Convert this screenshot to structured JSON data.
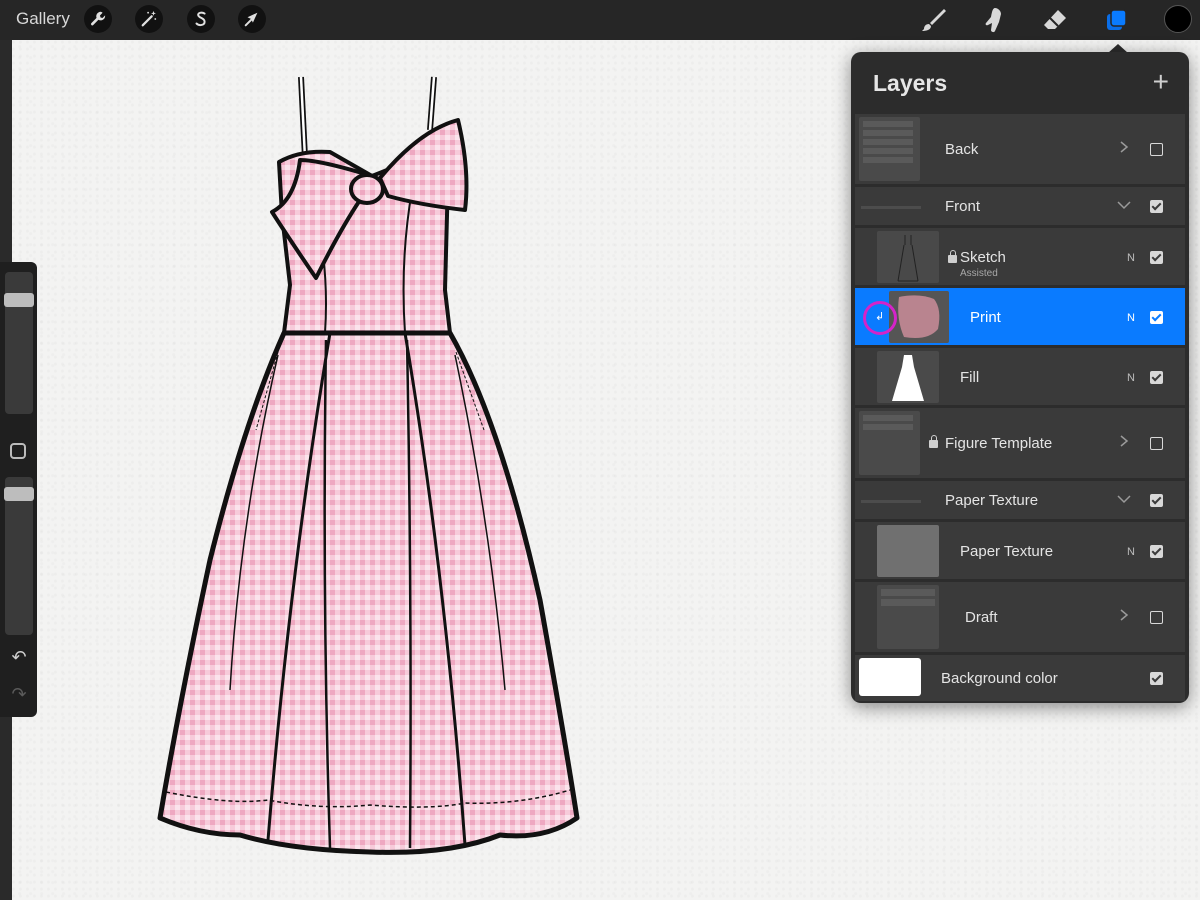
{
  "app": {
    "gallery_label": "Gallery",
    "toolbar_left": [
      {
        "name": "actions",
        "icon": "wrench-icon"
      },
      {
        "name": "adjustments",
        "icon": "magic-wand-icon"
      },
      {
        "name": "selection",
        "icon": "selection-s-icon"
      },
      {
        "name": "transform",
        "icon": "transform-arrow-icon"
      }
    ],
    "toolbar_right": [
      {
        "name": "brush",
        "icon": "brush-icon"
      },
      {
        "name": "smudge",
        "icon": "smudge-icon"
      },
      {
        "name": "eraser",
        "icon": "eraser-icon"
      },
      {
        "name": "layers",
        "icon": "layers-icon",
        "active": true
      }
    ],
    "current_color": "#000000",
    "accent_color": "#0a7bff"
  },
  "layers_panel": {
    "title": "Layers",
    "add_label": "+",
    "rows": [
      {
        "name": "Back",
        "type": "group-collapsed",
        "checked": false
      },
      {
        "name": "Front",
        "type": "group-expanded",
        "checked": true
      },
      {
        "name": "Sketch",
        "sub": "Assisted",
        "blend": "N",
        "locked": true,
        "checked": true
      },
      {
        "name": "Print",
        "blend": "N",
        "selected": true,
        "clipping": true,
        "checked": true
      },
      {
        "name": "Fill",
        "blend": "N",
        "checked": true
      },
      {
        "name": "Figure Template",
        "type": "group-collapsed",
        "locked": true,
        "checked": false
      },
      {
        "name": "Paper Texture",
        "type": "group-expanded",
        "checked": true
      },
      {
        "name": "Paper Texture",
        "blend": "N",
        "checked": true
      },
      {
        "name": "Draft",
        "type": "group-collapsed",
        "checked": false
      },
      {
        "name": "Background color",
        "type": "background",
        "checked": true
      }
    ]
  },
  "sidebar": {
    "undo_label": "↶",
    "redo_label": "↷"
  },
  "canvas": {
    "print_color": "#f6c6d6"
  }
}
